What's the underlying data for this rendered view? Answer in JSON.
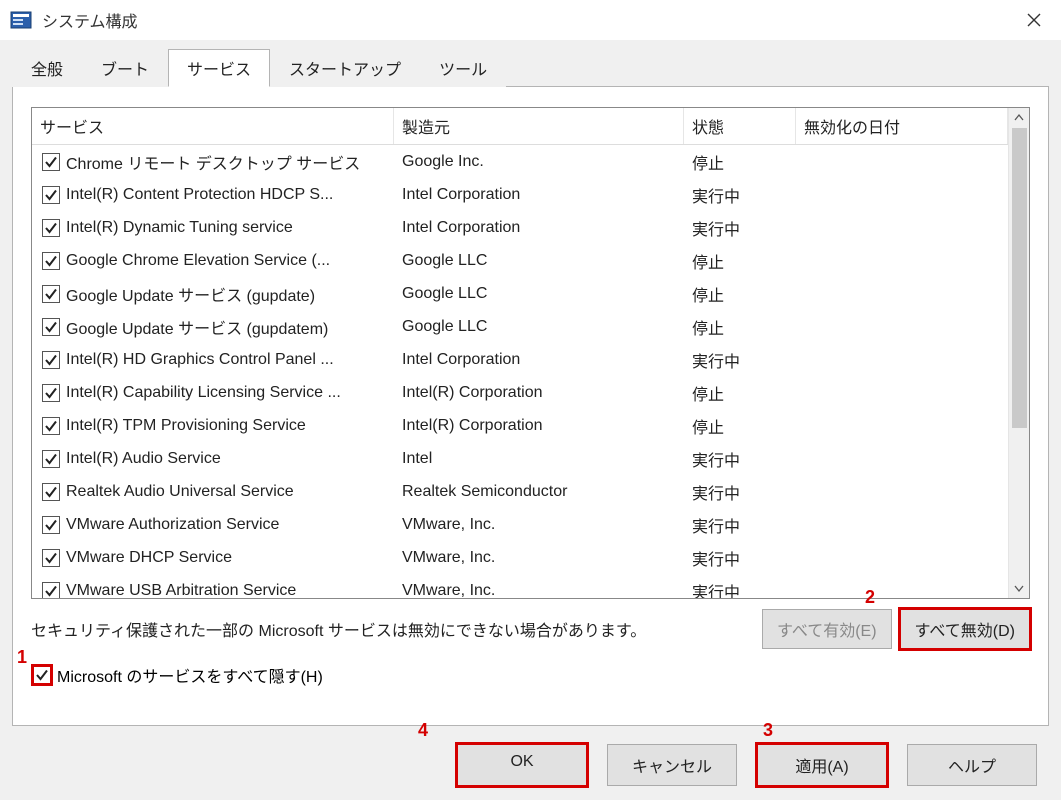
{
  "window": {
    "title": "システム構成"
  },
  "tabs": {
    "general": "全般",
    "boot": "ブート",
    "services": "サービス",
    "startup": "スタートアップ",
    "tools": "ツール"
  },
  "columns": {
    "service": "サービス",
    "manufacturer": "製造元",
    "status": "状態",
    "date_disabled": "無効化の日付"
  },
  "rows": [
    {
      "service": "Chrome リモート デスクトップ サービス",
      "mfr": "Google Inc.",
      "state": "停止",
      "checked": true
    },
    {
      "service": "Intel(R) Content Protection HDCP S...",
      "mfr": "Intel Corporation",
      "state": "実行中",
      "checked": true
    },
    {
      "service": "Intel(R) Dynamic Tuning service",
      "mfr": "Intel Corporation",
      "state": "実行中",
      "checked": true
    },
    {
      "service": "Google Chrome Elevation Service (...",
      "mfr": "Google LLC",
      "state": "停止",
      "checked": true
    },
    {
      "service": "Google Update サービス (gupdate)",
      "mfr": "Google LLC",
      "state": "停止",
      "checked": true
    },
    {
      "service": "Google Update サービス (gupdatem)",
      "mfr": "Google LLC",
      "state": "停止",
      "checked": true
    },
    {
      "service": "Intel(R) HD Graphics Control Panel ...",
      "mfr": "Intel Corporation",
      "state": "実行中",
      "checked": true
    },
    {
      "service": "Intel(R) Capability Licensing Service ...",
      "mfr": "Intel(R) Corporation",
      "state": "停止",
      "checked": true
    },
    {
      "service": "Intel(R) TPM Provisioning Service",
      "mfr": "Intel(R) Corporation",
      "state": "停止",
      "checked": true
    },
    {
      "service": "Intel(R) Audio Service",
      "mfr": "Intel",
      "state": "実行中",
      "checked": true
    },
    {
      "service": "Realtek Audio Universal Service",
      "mfr": "Realtek Semiconductor",
      "state": "実行中",
      "checked": true
    },
    {
      "service": "VMware Authorization Service",
      "mfr": "VMware, Inc.",
      "state": "実行中",
      "checked": true
    },
    {
      "service": "VMware DHCP Service",
      "mfr": "VMware, Inc.",
      "state": "実行中",
      "checked": true
    },
    {
      "service": "VMware USB Arbitration Service",
      "mfr": "VMware, Inc.",
      "state": "実行中",
      "checked": true
    }
  ],
  "note": "セキュリティ保護された一部の Microsoft サービスは無効にできない場合があります。",
  "buttons": {
    "enable_all": "すべて有効(E)",
    "disable_all": "すべて無効(D)",
    "ok": "OK",
    "cancel": "キャンセル",
    "apply": "適用(A)",
    "help": "ヘルプ"
  },
  "hide_ms": {
    "label": "Microsoft のサービスをすべて隠す(H)",
    "checked": true
  },
  "markers": {
    "m1": "1",
    "m2": "2",
    "m3": "3",
    "m4": "4"
  }
}
